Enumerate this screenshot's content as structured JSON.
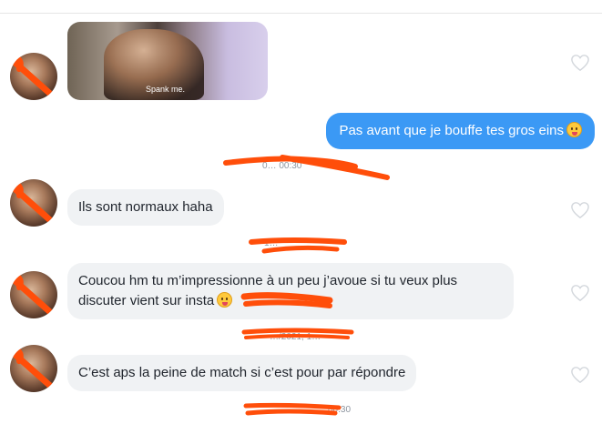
{
  "gif": {
    "caption": "Spank me."
  },
  "messages": [
    {
      "id": "out-1",
      "text": "Pas avant que je bouffe tes gros  eins"
    },
    {
      "id": "in-1",
      "text": "Ils sont normaux haha"
    },
    {
      "id": "in-2a",
      "text": "Coucou hm tu m’impressionne à un peu j’avoue si tu veux plus"
    },
    {
      "id": "in-2b",
      "text": "discuter vient sur insta"
    },
    {
      "id": "in-3",
      "text": "C’est aps la peine de match si c’est pour par répondre"
    }
  ],
  "timestamps": {
    "t1": "0…  00:30",
    "t2": "1…",
    "t3": "…/2021, 1…",
    "t4": "…00:30"
  },
  "colors": {
    "outgoing": "#3b99f5",
    "incoming": "#f0f2f4",
    "redaction": "#ff4e0a"
  }
}
